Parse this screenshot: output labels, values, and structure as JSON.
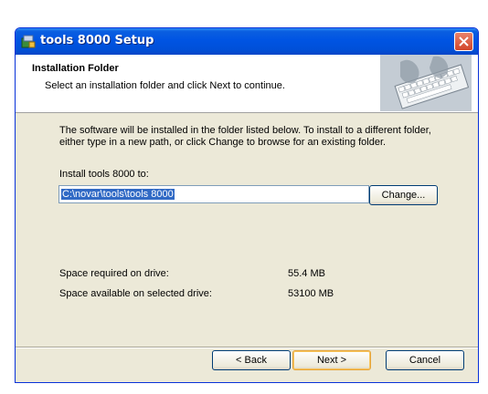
{
  "window": {
    "title": "tools 8000 Setup"
  },
  "banner": {
    "title": "Installation Folder",
    "subtitle": "Select an installation folder and click Next to continue."
  },
  "body": {
    "description": "The software will be installed in the folder listed below. To install to a different folder, either type in a new path, or click Change to browse for an existing folder.",
    "install_label": "Install tools 8000 to:",
    "install_path": "C:\\novar\\tools\\tools 8000",
    "change_label": "Change...",
    "space_required_label": "Space required on drive:",
    "space_required_value": "55.4 MB",
    "space_available_label": "Space available on selected drive:",
    "space_available_value": "53100 MB"
  },
  "footer": {
    "back_label": "< Back",
    "next_label": "Next >",
    "cancel_label": "Cancel"
  }
}
